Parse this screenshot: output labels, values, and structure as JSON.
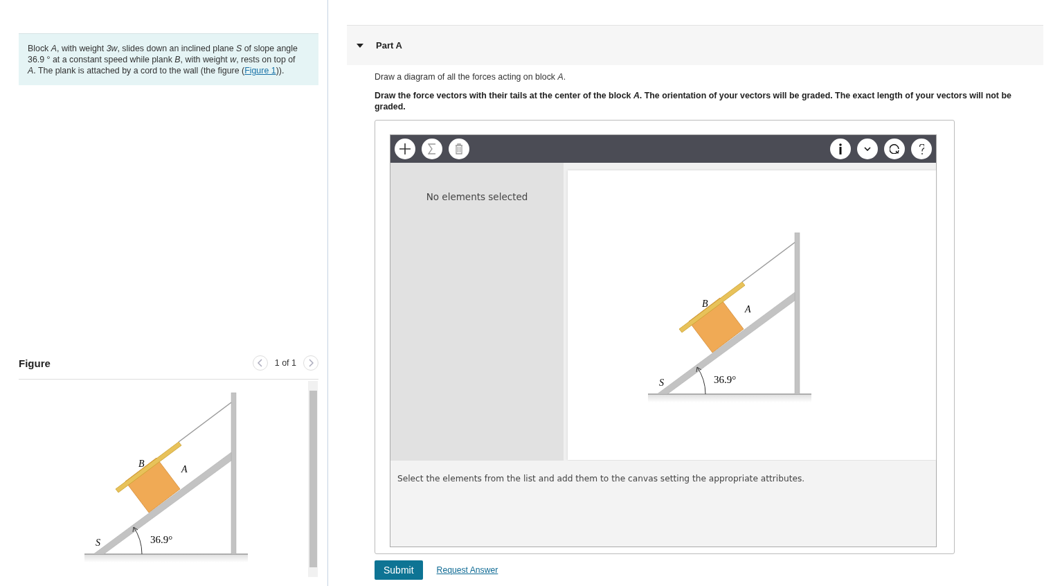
{
  "problem": {
    "text_before": "Block *A*, with weight *3w*, slides down an inclined plane *S*  of slope angle 36.9 °  at a constant speed while plank *B*, with weight *w*, rests on top of *A*. The plank is attached by a cord to the wall (the figure (",
    "link": "Figure 1",
    "text_after": "))."
  },
  "figure": {
    "heading": "Figure",
    "pager": "1 of 1",
    "diagram": {
      "plank": "B",
      "block": "A",
      "plane": "S",
      "angle": "36.9°"
    }
  },
  "part": {
    "title": "Part A",
    "expanded": true,
    "prompt": "Draw a diagram of all the forces acting on block *A*.",
    "instruction": "Draw the force vectors with their tails at the center of the block *A*. The orientation of your vectors will be graded. The exact length of your vectors will not be graded.",
    "widget": {
      "tools_left": [
        {
          "kind": "add"
        },
        {
          "kind": "sum"
        },
        {
          "kind": "delete"
        }
      ],
      "tools_right": [
        {
          "kind": "info"
        },
        {
          "kind": "dropdown"
        },
        {
          "kind": "reset"
        },
        {
          "kind": "help"
        }
      ],
      "selection_text": "No elements selected",
      "diagram": {
        "plank": "B",
        "block": "A",
        "plane": "S",
        "angle": "36.9°"
      },
      "hint": "Select the elements from the list and add them to the canvas setting the appropriate attributes."
    },
    "submit": "Submit",
    "request": "Request Answer"
  }
}
